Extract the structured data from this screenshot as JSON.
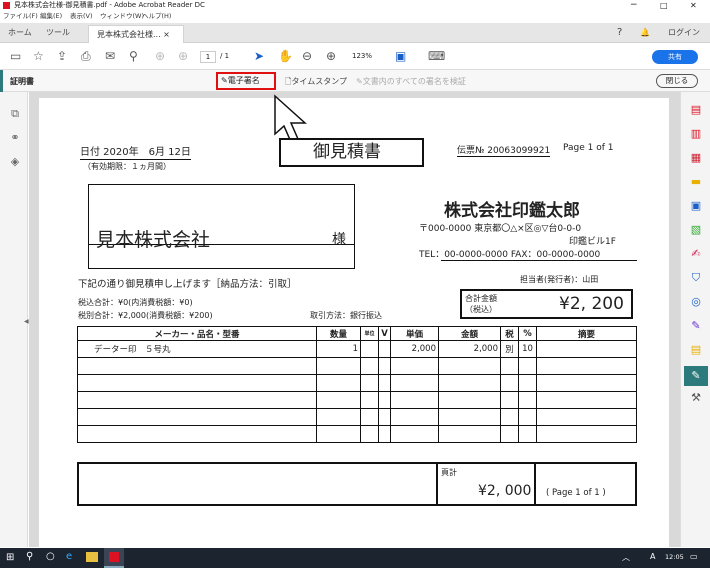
{
  "window": {
    "title": "見本株式会社様-御見積書.pdf - Adobe Acrobat Reader DC",
    "min": "−",
    "max": "□",
    "close": "✕"
  },
  "menu": [
    "ファイル(F)",
    "編集(E)",
    "表示(V)",
    "ウィンドウ(W)",
    "ヘルプ(H)"
  ],
  "tabs": {
    "home": "ホーム",
    "tools": "ツール",
    "doc": "見本株式会社様... ×",
    "help": "?",
    "bell": "🔔",
    "login": "ログイン"
  },
  "toolbar": {
    "page_current": "1",
    "page_total": "/ 1",
    "zoom": "123%",
    "share": "共有"
  },
  "sigbar": {
    "label": "証明書",
    "digital_sign": "電子署名",
    "timestamp": "タイムスタンプ",
    "verify_all": "文書内のすべての署名を検証",
    "close": "閉じる"
  },
  "annotation": {
    "callout": "御見積書"
  },
  "doc": {
    "date": "日付 2020年　6月 12日",
    "valid": "（有効期限：１ヵ月間）",
    "slip": "伝票№ 20063099921",
    "page": "Page 1 of 1",
    "client": "見本株式会社",
    "sama": "様",
    "company": "株式会社印鑑太郎",
    "addr1": "〒000-0000 東京都〇△×区◎▽台0-0-0",
    "addr2": "印鑑ビル1F",
    "tel": "TEL：00-0000-0000  FAX：00-0000-0000",
    "intro": "下記の通り御見積申し上げます［納品方法：引取］",
    "staff": "担当者(発行者)：山田",
    "tax_in": "税込合計：¥0(内消費税額：¥0)",
    "tax_out": "税別合計：¥2,000(消費税額：¥200)",
    "method": "取引方法：銀行振込",
    "total_label1": "合計金額",
    "total_label2": "（税込）",
    "total_value": "¥2, 200",
    "headers": [
      "メーカー・品名・型番",
      "数量",
      "単位",
      "V",
      "単価",
      "金額",
      "税",
      "%",
      "摘要"
    ],
    "row1": [
      "データー印　５号丸",
      "1",
      "",
      "",
      "2,000",
      "2,000",
      "別",
      "10",
      ""
    ],
    "subtotal_label": "頁計",
    "subtotal_value": "¥2, 000",
    "page_note": "( Page 1 of 1 )"
  },
  "taskbar": {
    "time": "12:05",
    "ime": "A"
  }
}
